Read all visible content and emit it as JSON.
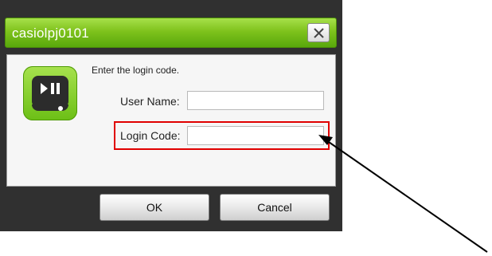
{
  "window": {
    "title": "casiolpj0101"
  },
  "icons": {
    "app": "projector-play-pause-icon",
    "close": "close-icon"
  },
  "dialog": {
    "prompt": "Enter the login code.",
    "user_name_label": "User Name:",
    "user_name_value": "",
    "login_code_label": "Login Code:",
    "login_code_value": ""
  },
  "buttons": {
    "ok_label": "OK",
    "cancel_label": "Cancel"
  },
  "colors": {
    "accent": "#7fc21c",
    "highlight": "#e00000",
    "frame": "#303030"
  }
}
